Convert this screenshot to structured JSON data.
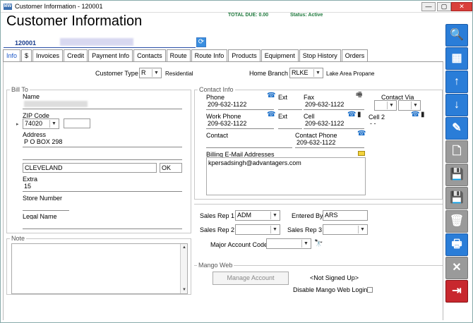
{
  "window": {
    "title": "Customer Information - 120001",
    "app_icon": "MW",
    "minimize": "—",
    "maximize": "▢",
    "close": "✕"
  },
  "header": {
    "title": "Customer Information",
    "total_due": "TOTAL DUE:  0.00",
    "status": "Status: Active"
  },
  "account": {
    "number": "120001",
    "refresh_icon": "refresh-icon"
  },
  "tabs": [
    "Info",
    "$",
    "Invoices",
    "Credit",
    "Payment Info",
    "Contacts",
    "Route",
    "Route Info",
    "Products",
    "Equipment",
    "Stop History",
    "Orders"
  ],
  "customer_type": {
    "label": "Customer Type",
    "value": "R",
    "desc": "Residential"
  },
  "home_branch": {
    "label": "Home Branch",
    "value": "RLKE",
    "desc": "Lake Area Propane"
  },
  "bill_to": {
    "title": "Bill To",
    "name_label": "Name",
    "zip_label": "ZIP Code",
    "zip": "74020",
    "address_label": "Address",
    "address1": "P O BOX 298",
    "address2": "",
    "city": "CLEVELAND",
    "state": "OK",
    "extra_label": "Extra",
    "extra": "15",
    "store_label": "Store Number",
    "legal_label": "Legal Name"
  },
  "note": {
    "title": "Note"
  },
  "contact": {
    "title": "Contact Info",
    "phone_label": "Phone",
    "phone": "209-632-1122",
    "ext_label": "Ext",
    "fax_label": "Fax",
    "fax": "209-632-1122",
    "via_label": "Contact Via",
    "work_label": "Work Phone",
    "work": "209-632-1122",
    "ext2_label": "Ext",
    "cell_label": "Cell",
    "cell": "209-632-1122",
    "cell2_label": "Cell 2",
    "cell2": "-  -",
    "contact_label": "Contact",
    "contact_phone_label": "Contact Phone",
    "contact_phone": "209-632-1122",
    "email_label": "Billing E-Mail Addresses",
    "email": "kpersadsingh@advantagers.com"
  },
  "sales": {
    "rep1_label": "Sales Rep 1",
    "rep1": "ADM",
    "entered_label": "Entered By",
    "entered": "ARS",
    "rep2_label": "Sales Rep 2",
    "rep3_label": "Sales Rep 3",
    "major_label": "Major Account Code"
  },
  "mango": {
    "title": "Mango Web",
    "manage": "Manage Account",
    "signup": "<Not Signed Up>",
    "disable": "Disable Mango Web Login"
  },
  "toolbar": [
    "search-icon",
    "grid-icon",
    "arrow-up-icon",
    "arrow-down-icon",
    "edit-icon",
    "new-document-icon",
    "save-new-icon",
    "save-icon",
    "delete-icon",
    "print-icon",
    "cancel-icon",
    "exit-icon"
  ],
  "toolbar_glyphs": [
    "🔍",
    "▦",
    "↑",
    "↓",
    "✎",
    "🗋",
    "💾",
    "💾",
    "🗑",
    "🖶",
    "✕",
    "⇥"
  ]
}
